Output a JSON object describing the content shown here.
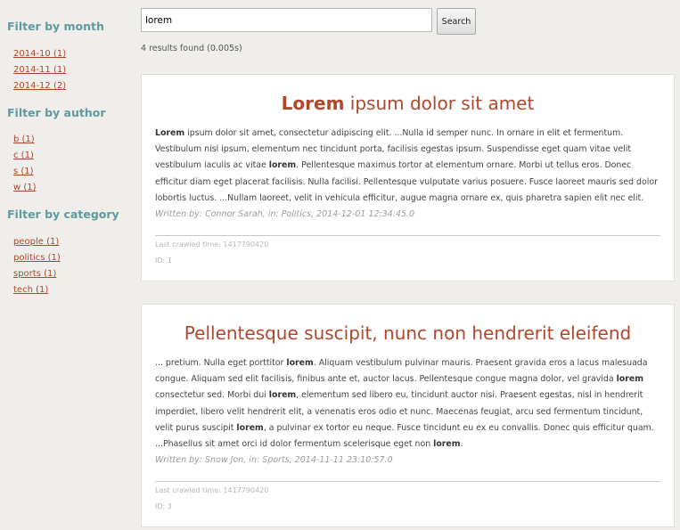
{
  "sidebar": {
    "month": {
      "heading": "Filter by month",
      "items": [
        "2014-10 (1)",
        "2014-11 (1)",
        "2014-12 (2)"
      ]
    },
    "author": {
      "heading": "Filter by author",
      "items": [
        "b (1)",
        "c (1)",
        "s (1)",
        "w (1)"
      ]
    },
    "category": {
      "heading": "Filter by category",
      "items": [
        "people (1)",
        "politics (1)",
        "sports (1)",
        "tech (1)"
      ]
    }
  },
  "search": {
    "query": "lorem",
    "button_label": "Search",
    "results_count": "4 results found (0.005s)"
  },
  "results": [
    {
      "title_parts": [
        {
          "text": "Lorem",
          "bold": true
        },
        {
          "text": " ipsum dolor sit amet",
          "bold": false
        }
      ],
      "snippet_parts": [
        {
          "text": "Lorem",
          "bold": true
        },
        {
          "text": " ipsum dolor sit amet, consectetur adipiscing elit. ...Nulla id semper nunc. In ornare in elit et fermentum. Vestibulum nisl ipsum, elementum nec tincidunt porta, facilisis egestas ipsum. Suspendisse eget quam vitae velit vestibulum iaculis ac vitae ",
          "bold": false
        },
        {
          "text": "lorem",
          "bold": true
        },
        {
          "text": ". Pellentesque maximus tortor at elementum ornare. Morbi ut tellus eros. Donec efficitur diam eget placerat facilisis. Nulla facilisi. Pellentesque vulputate varius posuere. Fusce laoreet mauris sed dolor lobortis luctus. ...Nullam laoreet, velit in vehicula efficitur, augue magna ornare ex, quis pharetra sapien elit nec elit.",
          "bold": false
        }
      ],
      "byline": "Written by: Connor Sarah, in: Politics, 2014-12-01 12:34:45.0",
      "crawled": "Last crawled time: 1417790420",
      "id": "ID: 1"
    },
    {
      "title_parts": [
        {
          "text": "Pellentesque suscipit, nunc non hendrerit eleifend",
          "bold": false
        }
      ],
      "snippet_parts": [
        {
          "text": "... pretium. Nulla eget porttitor ",
          "bold": false
        },
        {
          "text": "lorem",
          "bold": true
        },
        {
          "text": ". Aliquam vestibulum pulvinar mauris. Praesent gravida eros a lacus malesuada congue. Aliquam sed elit facilisis, finibus ante et, auctor lacus. Pellentesque congue magna dolor, vel gravida ",
          "bold": false
        },
        {
          "text": "lorem",
          "bold": true
        },
        {
          "text": " consectetur sed. Morbi dui ",
          "bold": false
        },
        {
          "text": "lorem",
          "bold": true
        },
        {
          "text": ", elementum sed libero eu, tincidunt auctor nisi. Praesent egestas, nisl in hendrerit imperdiet, libero velit hendrerit elit, a venenatis eros odio et nunc. Maecenas feugiat, arcu sed fermentum tincidunt, velit purus suscipit ",
          "bold": false
        },
        {
          "text": "lorem",
          "bold": true
        },
        {
          "text": ", a pulvinar ex tortor eu neque. Fusce tincidunt eu ex eu convallis. Donec quis efficitur quam. ...Phasellus sit amet orci id dolor fermentum scelerisque eget non ",
          "bold": false
        },
        {
          "text": "lorem",
          "bold": true
        },
        {
          "text": ".",
          "bold": false
        }
      ],
      "byline": "Written by: Snow Jon, in: Sports, 2014-11-11 23:10:57.0",
      "crawled": "Last crawled time: 1417790420",
      "id": "ID: 3"
    }
  ]
}
